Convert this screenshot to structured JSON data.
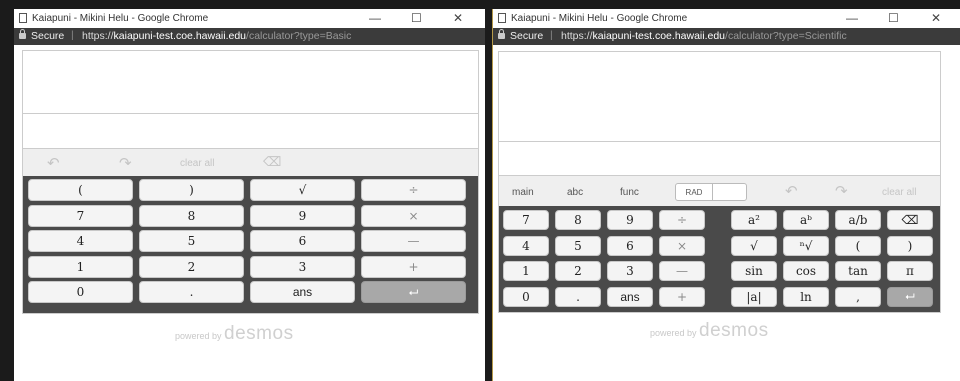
{
  "basic_window": {
    "title": "Kaiapuni - Mikini Helu - Google Chrome",
    "controls": [
      "—",
      "☐",
      "✕"
    ],
    "secure_label": "Secure",
    "url_scheme": "https://",
    "url_host": "kaiapuni-test.coe.hawaii.edu",
    "url_path": "/calculator?type=Basic",
    "toolbar": {
      "undo_icon": "undo-arrow",
      "redo_icon": "redo-arrow",
      "clear_all": "clear all",
      "backspace_icon": "backspace"
    },
    "keys": [
      [
        "(",
        ")",
        "√",
        "÷"
      ],
      [
        "7",
        "8",
        "9",
        "×"
      ],
      [
        "4",
        "5",
        "6",
        "—"
      ],
      [
        "1",
        "2",
        "3",
        "+"
      ],
      [
        "0",
        ".",
        "ans",
        "⮠"
      ]
    ],
    "powered_by": "powered by",
    "brand": "desmos"
  },
  "scientific_window": {
    "title": "Kaiapuni - Mikini Helu - Google Chrome",
    "controls": [
      "—",
      "☐",
      "✕"
    ],
    "secure_label": "Secure",
    "url_scheme": "https://",
    "url_host": "kaiapuni-test.coe.hawaii.edu",
    "url_path": "/calculator?type=Scientific",
    "tabs": {
      "main": "main",
      "abc": "abc",
      "func": "func",
      "rad": "RAD",
      "clear_all": "clear all"
    },
    "left_keys": [
      [
        "7",
        "8",
        "9",
        "÷"
      ],
      [
        "4",
        "5",
        "6",
        "×"
      ],
      [
        "1",
        "2",
        "3",
        "—"
      ],
      [
        "0",
        ".",
        "ans",
        "+"
      ]
    ],
    "right_keys": [
      [
        "a²",
        "aᵇ",
        "a/b",
        "⌫"
      ],
      [
        "√",
        "ⁿ√",
        "(",
        ")"
      ],
      [
        "sin",
        "cos",
        "tan",
        "π"
      ],
      [
        "|a|",
        "ln",
        ",",
        "⮠"
      ]
    ],
    "powered_by": "powered by",
    "brand": "desmos"
  },
  "colors": {
    "keyboard_bg": "#4a4a4a",
    "key_bg": "#f4f4f4",
    "enter_key": "#a8a8a8",
    "address_bar": "#3b3b3b"
  }
}
